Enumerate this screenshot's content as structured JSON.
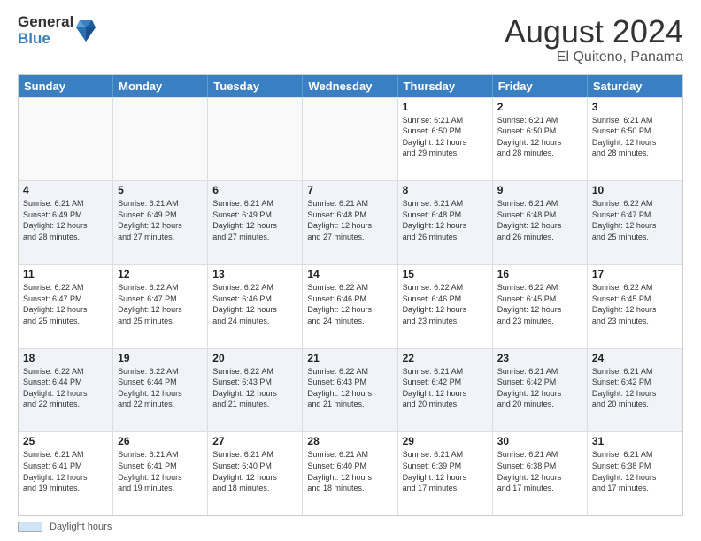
{
  "logo": {
    "line1": "General",
    "line2": "Blue"
  },
  "title": "August 2024",
  "location": "El Quiteno, Panama",
  "days_of_week": [
    "Sunday",
    "Monday",
    "Tuesday",
    "Wednesday",
    "Thursday",
    "Friday",
    "Saturday"
  ],
  "footer_label": "Daylight hours",
  "weeks": [
    [
      {
        "day": "",
        "info": ""
      },
      {
        "day": "",
        "info": ""
      },
      {
        "day": "",
        "info": ""
      },
      {
        "day": "",
        "info": ""
      },
      {
        "day": "1",
        "info": "Sunrise: 6:21 AM\nSunset: 6:50 PM\nDaylight: 12 hours\nand 29 minutes."
      },
      {
        "day": "2",
        "info": "Sunrise: 6:21 AM\nSunset: 6:50 PM\nDaylight: 12 hours\nand 28 minutes."
      },
      {
        "day": "3",
        "info": "Sunrise: 6:21 AM\nSunset: 6:50 PM\nDaylight: 12 hours\nand 28 minutes."
      }
    ],
    [
      {
        "day": "4",
        "info": "Sunrise: 6:21 AM\nSunset: 6:49 PM\nDaylight: 12 hours\nand 28 minutes."
      },
      {
        "day": "5",
        "info": "Sunrise: 6:21 AM\nSunset: 6:49 PM\nDaylight: 12 hours\nand 27 minutes."
      },
      {
        "day": "6",
        "info": "Sunrise: 6:21 AM\nSunset: 6:49 PM\nDaylight: 12 hours\nand 27 minutes."
      },
      {
        "day": "7",
        "info": "Sunrise: 6:21 AM\nSunset: 6:48 PM\nDaylight: 12 hours\nand 27 minutes."
      },
      {
        "day": "8",
        "info": "Sunrise: 6:21 AM\nSunset: 6:48 PM\nDaylight: 12 hours\nand 26 minutes."
      },
      {
        "day": "9",
        "info": "Sunrise: 6:21 AM\nSunset: 6:48 PM\nDaylight: 12 hours\nand 26 minutes."
      },
      {
        "day": "10",
        "info": "Sunrise: 6:22 AM\nSunset: 6:47 PM\nDaylight: 12 hours\nand 25 minutes."
      }
    ],
    [
      {
        "day": "11",
        "info": "Sunrise: 6:22 AM\nSunset: 6:47 PM\nDaylight: 12 hours\nand 25 minutes."
      },
      {
        "day": "12",
        "info": "Sunrise: 6:22 AM\nSunset: 6:47 PM\nDaylight: 12 hours\nand 25 minutes."
      },
      {
        "day": "13",
        "info": "Sunrise: 6:22 AM\nSunset: 6:46 PM\nDaylight: 12 hours\nand 24 minutes."
      },
      {
        "day": "14",
        "info": "Sunrise: 6:22 AM\nSunset: 6:46 PM\nDaylight: 12 hours\nand 24 minutes."
      },
      {
        "day": "15",
        "info": "Sunrise: 6:22 AM\nSunset: 6:46 PM\nDaylight: 12 hours\nand 23 minutes."
      },
      {
        "day": "16",
        "info": "Sunrise: 6:22 AM\nSunset: 6:45 PM\nDaylight: 12 hours\nand 23 minutes."
      },
      {
        "day": "17",
        "info": "Sunrise: 6:22 AM\nSunset: 6:45 PM\nDaylight: 12 hours\nand 23 minutes."
      }
    ],
    [
      {
        "day": "18",
        "info": "Sunrise: 6:22 AM\nSunset: 6:44 PM\nDaylight: 12 hours\nand 22 minutes."
      },
      {
        "day": "19",
        "info": "Sunrise: 6:22 AM\nSunset: 6:44 PM\nDaylight: 12 hours\nand 22 minutes."
      },
      {
        "day": "20",
        "info": "Sunrise: 6:22 AM\nSunset: 6:43 PM\nDaylight: 12 hours\nand 21 minutes."
      },
      {
        "day": "21",
        "info": "Sunrise: 6:22 AM\nSunset: 6:43 PM\nDaylight: 12 hours\nand 21 minutes."
      },
      {
        "day": "22",
        "info": "Sunrise: 6:21 AM\nSunset: 6:42 PM\nDaylight: 12 hours\nand 20 minutes."
      },
      {
        "day": "23",
        "info": "Sunrise: 6:21 AM\nSunset: 6:42 PM\nDaylight: 12 hours\nand 20 minutes."
      },
      {
        "day": "24",
        "info": "Sunrise: 6:21 AM\nSunset: 6:42 PM\nDaylight: 12 hours\nand 20 minutes."
      }
    ],
    [
      {
        "day": "25",
        "info": "Sunrise: 6:21 AM\nSunset: 6:41 PM\nDaylight: 12 hours\nand 19 minutes."
      },
      {
        "day": "26",
        "info": "Sunrise: 6:21 AM\nSunset: 6:41 PM\nDaylight: 12 hours\nand 19 minutes."
      },
      {
        "day": "27",
        "info": "Sunrise: 6:21 AM\nSunset: 6:40 PM\nDaylight: 12 hours\nand 18 minutes."
      },
      {
        "day": "28",
        "info": "Sunrise: 6:21 AM\nSunset: 6:40 PM\nDaylight: 12 hours\nand 18 minutes."
      },
      {
        "day": "29",
        "info": "Sunrise: 6:21 AM\nSunset: 6:39 PM\nDaylight: 12 hours\nand 17 minutes."
      },
      {
        "day": "30",
        "info": "Sunrise: 6:21 AM\nSunset: 6:38 PM\nDaylight: 12 hours\nand 17 minutes."
      },
      {
        "day": "31",
        "info": "Sunrise: 6:21 AM\nSunset: 6:38 PM\nDaylight: 12 hours\nand 17 minutes."
      }
    ]
  ]
}
